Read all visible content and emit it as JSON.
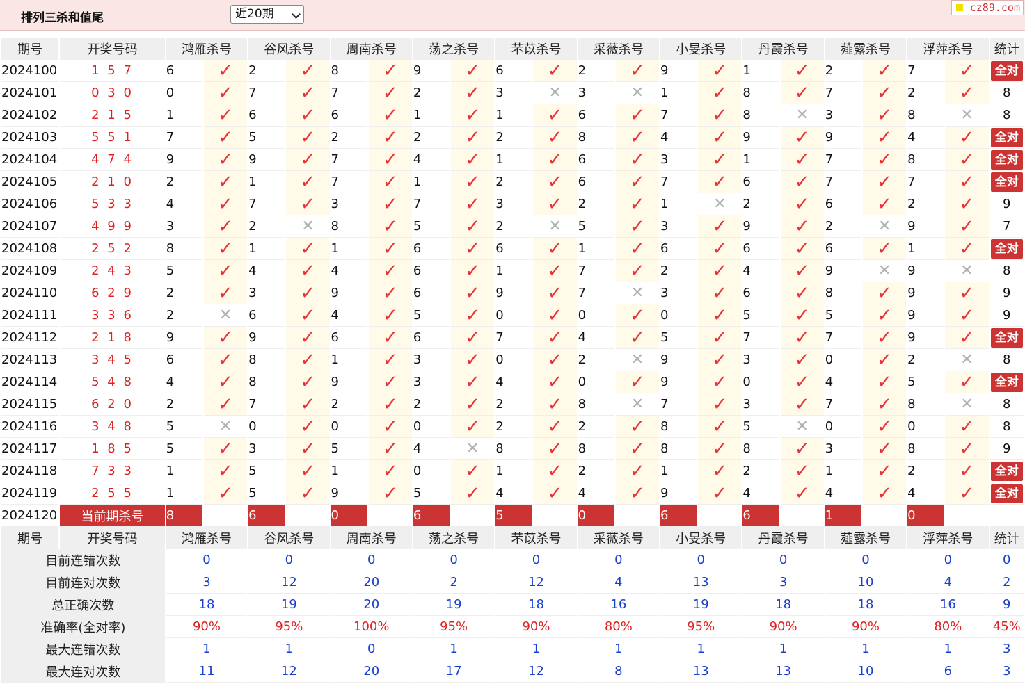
{
  "header": {
    "title": "排列三杀和值尾",
    "period_selected": "近20期",
    "brand": "cz89.com"
  },
  "columns": {
    "issue": "期号",
    "draw": "开奖号码",
    "experts": [
      "鸿雁杀号",
      "谷风杀号",
      "周南杀号",
      "荡之杀号",
      "芣苡杀号",
      "采薇杀号",
      "小旻杀号",
      "丹霞杀号",
      "薤露杀号",
      "浮萍杀号"
    ],
    "stat": "统计"
  },
  "all_correct_label": "全对",
  "rows": [
    {
      "issue": "2024100",
      "draw": "1 5 7",
      "kills": [
        6,
        2,
        8,
        9,
        6,
        2,
        9,
        1,
        2,
        7
      ],
      "ok": [
        1,
        1,
        1,
        1,
        1,
        1,
        1,
        1,
        1,
        1
      ],
      "stat": "全对"
    },
    {
      "issue": "2024101",
      "draw": "0 3 0",
      "kills": [
        0,
        7,
        7,
        2,
        3,
        3,
        1,
        8,
        7,
        2
      ],
      "ok": [
        1,
        1,
        1,
        1,
        0,
        0,
        1,
        1,
        1,
        1
      ],
      "stat": "8"
    },
    {
      "issue": "2024102",
      "draw": "2 1 5",
      "kills": [
        1,
        6,
        6,
        1,
        1,
        6,
        7,
        8,
        3,
        8
      ],
      "ok": [
        1,
        1,
        1,
        1,
        1,
        1,
        1,
        0,
        1,
        0
      ],
      "stat": "8"
    },
    {
      "issue": "2024103",
      "draw": "5 5 1",
      "kills": [
        7,
        5,
        2,
        2,
        2,
        8,
        4,
        9,
        9,
        4
      ],
      "ok": [
        1,
        1,
        1,
        1,
        1,
        1,
        1,
        1,
        1,
        1
      ],
      "stat": "全对"
    },
    {
      "issue": "2024104",
      "draw": "4 7 4",
      "kills": [
        9,
        9,
        7,
        4,
        1,
        6,
        3,
        1,
        7,
        8
      ],
      "ok": [
        1,
        1,
        1,
        1,
        1,
        1,
        1,
        1,
        1,
        1
      ],
      "stat": "全对"
    },
    {
      "issue": "2024105",
      "draw": "2 1 0",
      "kills": [
        2,
        1,
        7,
        1,
        2,
        6,
        7,
        6,
        7,
        7
      ],
      "ok": [
        1,
        1,
        1,
        1,
        1,
        1,
        1,
        1,
        1,
        1
      ],
      "stat": "全对"
    },
    {
      "issue": "2024106",
      "draw": "5 3 3",
      "kills": [
        4,
        7,
        3,
        7,
        3,
        2,
        1,
        2,
        6,
        2
      ],
      "ok": [
        1,
        1,
        1,
        1,
        1,
        1,
        0,
        1,
        1,
        1
      ],
      "stat": "9"
    },
    {
      "issue": "2024107",
      "draw": "4 9 9",
      "kills": [
        3,
        2,
        8,
        5,
        2,
        5,
        3,
        9,
        2,
        9
      ],
      "ok": [
        1,
        0,
        1,
        1,
        0,
        1,
        1,
        1,
        0,
        1
      ],
      "stat": "7"
    },
    {
      "issue": "2024108",
      "draw": "2 5 2",
      "kills": [
        8,
        1,
        1,
        6,
        6,
        1,
        6,
        6,
        6,
        1
      ],
      "ok": [
        1,
        1,
        1,
        1,
        1,
        1,
        1,
        1,
        1,
        1
      ],
      "stat": "全对"
    },
    {
      "issue": "2024109",
      "draw": "2 4 3",
      "kills": [
        5,
        4,
        4,
        6,
        1,
        7,
        2,
        4,
        9,
        9
      ],
      "ok": [
        1,
        1,
        1,
        1,
        1,
        1,
        1,
        1,
        0,
        0
      ],
      "stat": "8"
    },
    {
      "issue": "2024110",
      "draw": "6 2 9",
      "kills": [
        2,
        3,
        9,
        6,
        9,
        7,
        3,
        6,
        8,
        9
      ],
      "ok": [
        1,
        1,
        1,
        1,
        1,
        0,
        1,
        1,
        1,
        1
      ],
      "stat": "9"
    },
    {
      "issue": "2024111",
      "draw": "3 3 6",
      "kills": [
        2,
        6,
        4,
        5,
        0,
        0,
        0,
        5,
        5,
        9
      ],
      "ok": [
        0,
        1,
        1,
        1,
        1,
        1,
        1,
        1,
        1,
        1
      ],
      "stat": "9"
    },
    {
      "issue": "2024112",
      "draw": "2 1 8",
      "kills": [
        9,
        9,
        6,
        6,
        7,
        4,
        5,
        7,
        7,
        9
      ],
      "ok": [
        1,
        1,
        1,
        1,
        1,
        1,
        1,
        1,
        1,
        1
      ],
      "stat": "全对"
    },
    {
      "issue": "2024113",
      "draw": "3 4 5",
      "kills": [
        6,
        8,
        1,
        3,
        0,
        2,
        9,
        3,
        0,
        2
      ],
      "ok": [
        1,
        1,
        1,
        1,
        1,
        0,
        1,
        1,
        1,
        0
      ],
      "stat": "8"
    },
    {
      "issue": "2024114",
      "draw": "5 4 8",
      "kills": [
        4,
        8,
        9,
        3,
        4,
        0,
        9,
        0,
        4,
        5
      ],
      "ok": [
        1,
        1,
        1,
        1,
        1,
        1,
        1,
        1,
        1,
        1
      ],
      "stat": "全对"
    },
    {
      "issue": "2024115",
      "draw": "6 2 0",
      "kills": [
        2,
        7,
        2,
        2,
        2,
        8,
        7,
        3,
        7,
        8
      ],
      "ok": [
        1,
        1,
        1,
        1,
        1,
        0,
        1,
        1,
        1,
        0
      ],
      "stat": "8"
    },
    {
      "issue": "2024116",
      "draw": "3 4 8",
      "kills": [
        5,
        0,
        0,
        0,
        2,
        2,
        8,
        5,
        0,
        0
      ],
      "ok": [
        0,
        1,
        1,
        1,
        1,
        1,
        1,
        0,
        1,
        1
      ],
      "stat": "8"
    },
    {
      "issue": "2024117",
      "draw": "1 8 5",
      "kills": [
        5,
        3,
        5,
        4,
        8,
        8,
        8,
        8,
        3,
        8
      ],
      "ok": [
        1,
        1,
        1,
        0,
        1,
        1,
        1,
        1,
        1,
        1
      ],
      "stat": "9"
    },
    {
      "issue": "2024118",
      "draw": "7 3 3",
      "kills": [
        1,
        5,
        1,
        0,
        1,
        2,
        1,
        2,
        1,
        2
      ],
      "ok": [
        1,
        1,
        1,
        1,
        1,
        1,
        1,
        1,
        1,
        1
      ],
      "stat": "全对"
    },
    {
      "issue": "2024119",
      "draw": "2 5 5",
      "kills": [
        1,
        5,
        9,
        5,
        4,
        4,
        9,
        4,
        4,
        4
      ],
      "ok": [
        1,
        1,
        1,
        1,
        1,
        1,
        1,
        1,
        1,
        1
      ],
      "stat": "全对"
    }
  ],
  "current": {
    "issue": "2024120",
    "label": "当前期杀号",
    "kills": [
      8,
      6,
      0,
      6,
      5,
      0,
      6,
      6,
      1,
      0
    ]
  },
  "summary": [
    {
      "label": "目前连错次数",
      "values": [
        "0",
        "0",
        "0",
        "0",
        "0",
        "0",
        "0",
        "0",
        "0",
        "0",
        "0"
      ],
      "red": false
    },
    {
      "label": "目前连对次数",
      "values": [
        "3",
        "12",
        "20",
        "2",
        "12",
        "4",
        "13",
        "3",
        "10",
        "4",
        "2"
      ],
      "red": false
    },
    {
      "label": "总正确次数",
      "values": [
        "18",
        "19",
        "20",
        "19",
        "18",
        "16",
        "19",
        "18",
        "18",
        "16",
        "9"
      ],
      "red": false
    },
    {
      "label": "准确率(全对率)",
      "values": [
        "90%",
        "95%",
        "100%",
        "95%",
        "90%",
        "80%",
        "95%",
        "90%",
        "90%",
        "80%",
        "45%"
      ],
      "red": true
    },
    {
      "label": "最大连错次数",
      "values": [
        "1",
        "1",
        "0",
        "1",
        "1",
        "1",
        "1",
        "1",
        "1",
        "1",
        "3"
      ],
      "red": false
    },
    {
      "label": "最大连对次数",
      "values": [
        "11",
        "12",
        "20",
        "17",
        "12",
        "8",
        "13",
        "13",
        "10",
        "6",
        "3"
      ],
      "red": false
    }
  ],
  "colors": {
    "accent_red": "#cc3333",
    "tick_red": "#e8323a",
    "value_blue": "#1a3fcc",
    "header_bg": "#fbe6e6"
  }
}
